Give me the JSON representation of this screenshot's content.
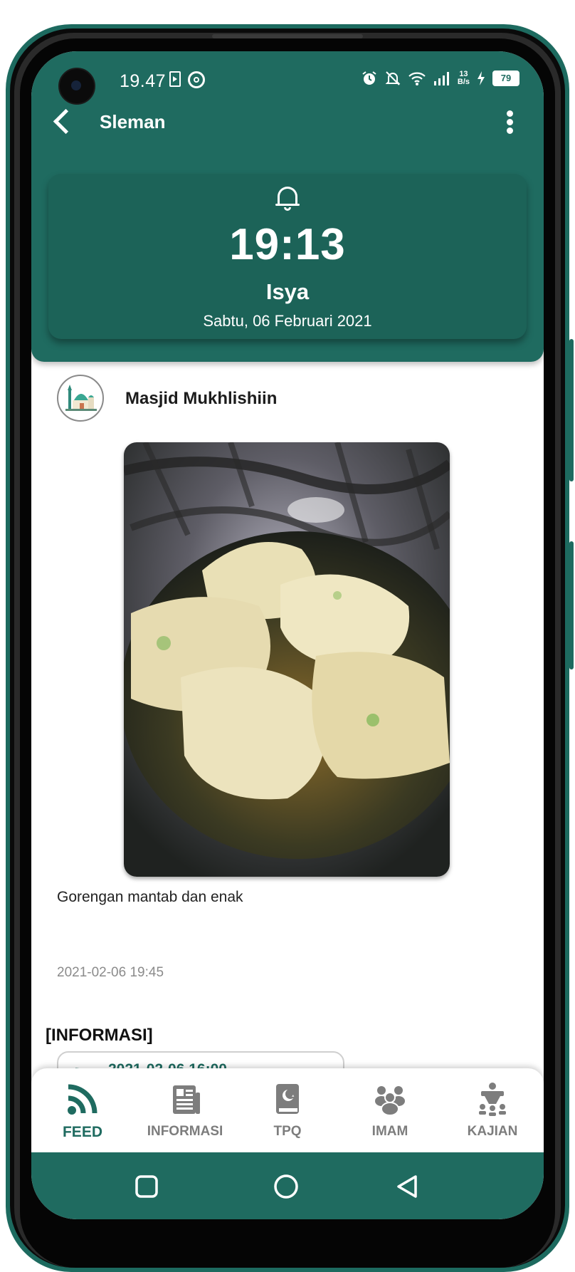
{
  "status_bar": {
    "time": "19.47",
    "net_speed_top": "13",
    "net_speed_bottom": "B/s",
    "battery": "79",
    "icons": [
      "document-icon",
      "sync-circle-icon",
      "alarm-icon",
      "bell-off-icon",
      "wifi-icon",
      "signal-icon",
      "charging-icon",
      "battery-icon"
    ]
  },
  "app_bar": {
    "title": "Sleman",
    "back_icon": "chevron-left-icon",
    "menu_icon": "more-vertical-icon"
  },
  "prayer": {
    "icon": "bell-icon",
    "time": "19:13",
    "name": "Isya",
    "date": "Sabtu, 06 Februari 2021"
  },
  "post": {
    "author": "Masjid Mukhlishiin",
    "avatar_icon": "mosque-icon",
    "caption": "Gorengan mantab dan enak",
    "timestamp": "2021-02-06 19:45"
  },
  "info_section": {
    "title": "[INFORMASI]",
    "first_item_text": "2021-02-06 16:00"
  },
  "bottom_nav": {
    "items": [
      {
        "label": "FEED",
        "icon": "rss-feed-icon",
        "active": true
      },
      {
        "label": "INFORMASI",
        "icon": "newspaper-icon",
        "active": false
      },
      {
        "label": "TPQ",
        "icon": "quran-book-icon",
        "active": false
      },
      {
        "label": "IMAM",
        "icon": "group-icon",
        "active": false
      },
      {
        "label": "KAJIAN",
        "icon": "lecture-icon",
        "active": false
      }
    ]
  },
  "colors": {
    "primary": "#1f6b60",
    "card": "#1c6358",
    "inactive": "#7d7d7d"
  }
}
